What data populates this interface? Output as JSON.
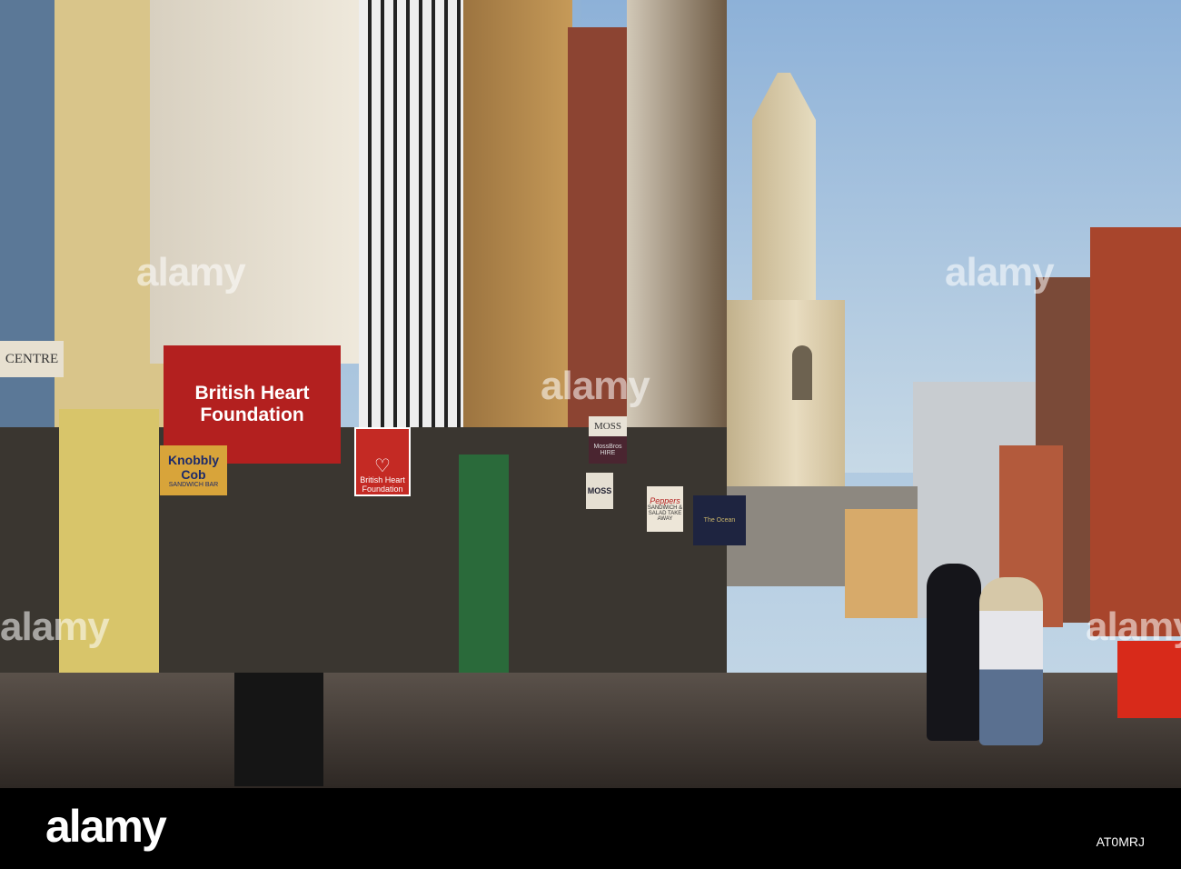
{
  "signs": {
    "centre": "CENTRE",
    "bhf_fascia": "British Heart Foundation",
    "bhf_hanging": "British Heart Foundation",
    "knobbly_cob": "Knobbly Cob",
    "knobbly_cob_sub": "SANDWICH BAR",
    "moss": "MOSS",
    "moss_bros": "MossBros",
    "moss_bros_sub": "HIRE",
    "moss_lower": "MOSS",
    "peppers": "Peppers",
    "peppers_sub": "SANDWICH & SALAD TAKE AWAY",
    "pub": "The Ocean"
  },
  "watermarks": [
    "alamy",
    "alamy",
    "alamy",
    "alamy",
    "alamy"
  ],
  "footer": {
    "logo": "alamy",
    "image_code": "AT0MRJ"
  },
  "colors": {
    "sky": "#8fb2d6",
    "bhf_red": "#b3201f",
    "stone": "#d8c9a0",
    "footer": "#000000"
  }
}
